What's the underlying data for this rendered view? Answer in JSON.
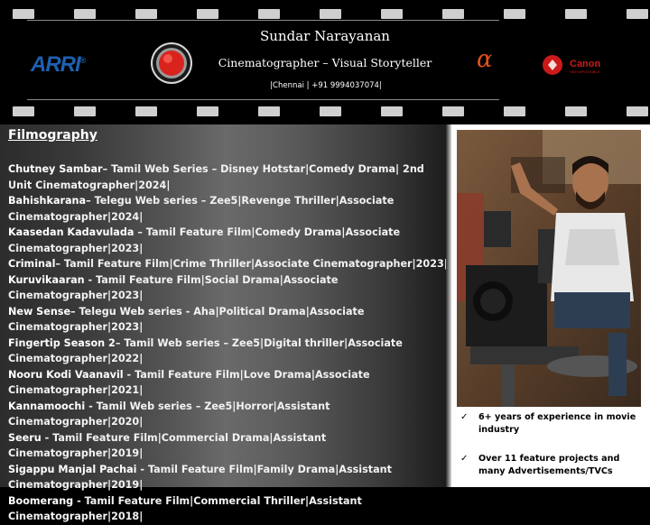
{
  "header": {
    "name": "Sundar Narayanan",
    "role": "Cinematographer – Visual Storyteller",
    "contact": "|Chennai | +91 9994037074|"
  },
  "logos": {
    "arri": "ARRI",
    "arri_mark": "®",
    "red_icon": "red-camera-logo",
    "sony_alpha": "α",
    "canon": "Canon",
    "canon_tagline": "SEE IMPOSSIBLE"
  },
  "colors": {
    "arri_blue": "#1f5fb0",
    "red_logo": "#d9231d",
    "sony_orange": "#e5501c",
    "canon_red": "#cc1a1a"
  },
  "filmography": {
    "heading": "Filmography",
    "entries": [
      {
        "title": "Chutney Sambar",
        "desc": "– Tamil  Web Series – Disney Hotstar|Comedy Drama| 2nd Unit Cinematographer|2024|"
      },
      {
        "title": "Bahishkarana",
        "desc": "– Telegu Web series – Zee5|Revenge Thriller|Associate Cinematographer|2024|"
      },
      {
        "title": "Kaasedan Kadavulada",
        "desc": " – Tamil Feature Film|Comedy Drama|Associate Cinematographer|2023|"
      },
      {
        "title": "Criminal",
        "desc": "– Tamil  Feature Film|Crime Thriller|Associate Cinematographer|2023|"
      },
      {
        "title": "Kuruvikaaran",
        "desc": " -  Tamil  Feature Film|Social Drama|Associate Cinematographer|2023|"
      },
      {
        "title": "New Sense",
        "desc": "– Telegu Web series - Aha|Political Drama|Associate Cinematographer|2023|"
      },
      {
        "title": "Fingertip Season 2",
        "desc": "– Tamil  Web series – Zee5|Digital thriller|Associate Cinematographer|2022|"
      },
      {
        "title": "Nooru Kodi Vaanavil",
        "desc": " - Tamil Feature Film|Love Drama|Associate Cinematographer|2021|"
      },
      {
        "title": "Kannamoochi",
        "desc": " - Tamil  Web series – Zee5|Horror|Assistant Cinematographer|2020|"
      },
      {
        "title": "Seeru",
        "desc": "  - Tamil Feature Film|Commercial Drama|Assistant Cinematographer|2019|"
      },
      {
        "title": "Sigappu Manjal Pachai",
        "desc": "  - Tamil Feature Film|Family Drama|Assistant Cinematographer|2019|"
      },
      {
        "title": "Boomerang",
        "desc": "  - Tamil Feature Film|Commercial Thriller|Assistant Cinematographer|2018|"
      }
    ]
  },
  "highlights": {
    "check_icon": "checkmark-icon",
    "items": [
      "6+ years of experience in movie industry",
      "Over 11 feature projects and many Advertisements/TVCs"
    ]
  }
}
